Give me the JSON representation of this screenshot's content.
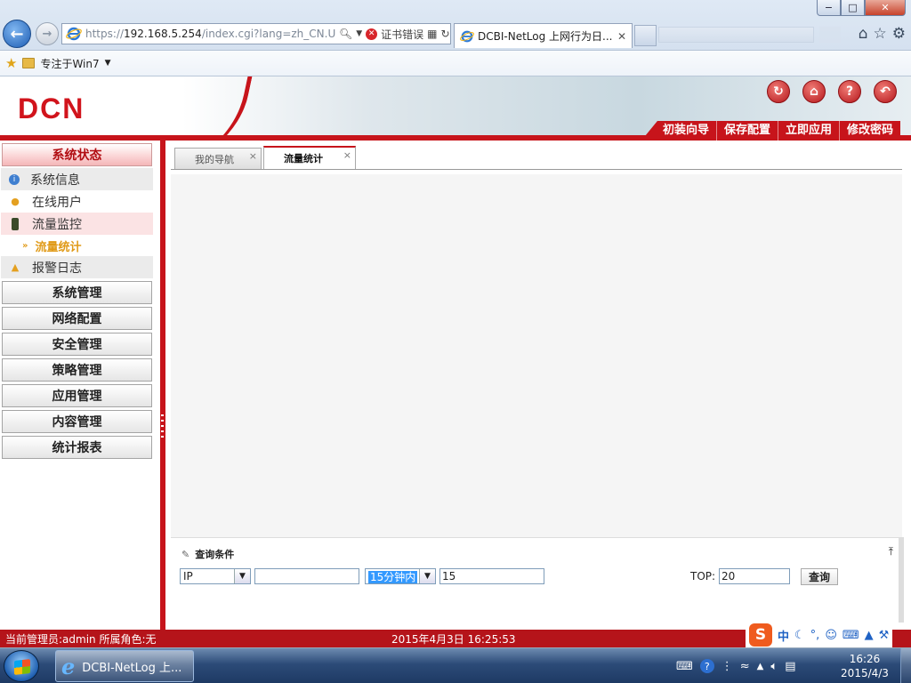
{
  "browser": {
    "url_prefix": "https://",
    "url_host": "192.168.5.254",
    "url_rest": "/index.cgi?lang=zh_CN.U",
    "cert_error": "证书错误",
    "tab_title": "DCBI-NetLog 上网行为日...",
    "tab_close": "✕",
    "favorites_item": "专注于Win7",
    "window_buttons": {
      "min": "−",
      "max": "□",
      "close": "✕"
    }
  },
  "app": {
    "logo": "DCN",
    "header_buttons": [
      "初装向导",
      "保存配置",
      "立即应用",
      "修改密码"
    ],
    "header_icons": [
      "refresh-icon",
      "home-icon",
      "help-icon",
      "logout-icon"
    ]
  },
  "sidebar": {
    "active_group": "系统状态",
    "sub_items": [
      {
        "label": "系统信息",
        "icon": "info-icon"
      },
      {
        "label": "在线用户",
        "icon": "user-icon"
      },
      {
        "label": "流量监控",
        "icon": "traffic-light-icon"
      }
    ],
    "sub_sub_item": "流量统计",
    "after_item": {
      "label": "报警日志",
      "icon": "alarm-icon"
    },
    "groups": [
      "系统管理",
      "网络配置",
      "安全管理",
      "策略管理",
      "应用管理",
      "内容管理",
      "统计报表"
    ]
  },
  "content": {
    "tabs": [
      {
        "label": "我的导航",
        "active": false
      },
      {
        "label": "流量统计",
        "active": true
      }
    ],
    "query": {
      "title": "查询条件",
      "type_select": "IP",
      "text_value": "",
      "range_select": "15分钟内",
      "range_value": "15",
      "top_label": "TOP:",
      "top_value": "20",
      "button": "查询"
    }
  },
  "status": {
    "admin_text": "当前管理员:admin  所属角色:无",
    "datetime": "2015年4月3日  16:25:53"
  },
  "ime": {
    "logo": "S",
    "lang": "中"
  },
  "taskbar": {
    "task_label": "DCBI-NetLog 上...",
    "time": "16:26",
    "date": "2015/4/3"
  },
  "colors": {
    "brand_red": "#c7141b",
    "active_text": "#b10d12",
    "sub_active": "#e09a18"
  }
}
